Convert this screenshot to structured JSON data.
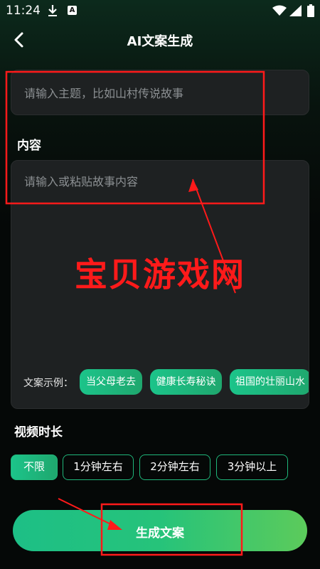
{
  "status_bar": {
    "time": "11:24",
    "app_badge": "A",
    "icons": [
      "download-icon",
      "a-notification-icon",
      "wifi-icon",
      "signal-icon",
      "battery-icon"
    ]
  },
  "header": {
    "back_icon": "back-arrow-icon",
    "title": "AI文案生成"
  },
  "form": {
    "title_placeholder": "请输入主题，比如山村传说故事",
    "content_label": "内容",
    "content_placeholder": "请输入或粘贴故事内容",
    "examples_label": "文案示例：",
    "examples": [
      "当父母老去",
      "健康长寿秘诀",
      "祖国的壮丽山水"
    ]
  },
  "watermark": "宝贝游戏网",
  "duration": {
    "label": "视频时长",
    "options": [
      "不限",
      "1分钟左右",
      "2分钟左右",
      "3分钟以上"
    ],
    "selected": "不限"
  },
  "generate_button": {
    "label": "生成文案"
  },
  "colors": {
    "accent": "#1fb67a",
    "annotation": "#ff1a1a",
    "background": "#050807"
  }
}
